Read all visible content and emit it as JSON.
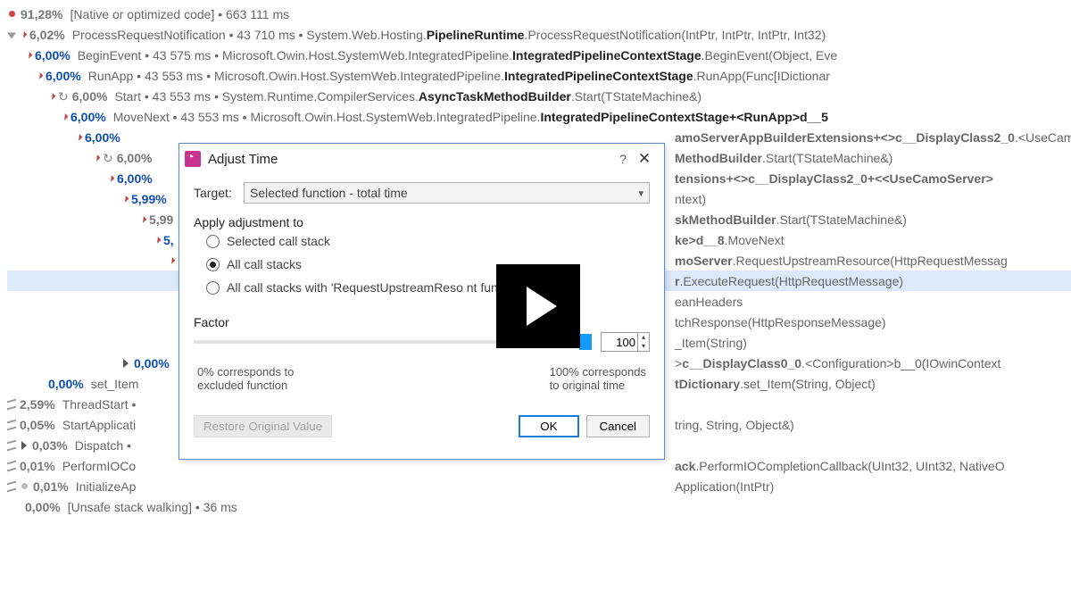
{
  "rows": [
    {
      "indent": 0,
      "glyph": "dot-red",
      "pct": "91,28%",
      "pctStyle": "gray",
      "text": "[Native or optimized code]  •  663 111 ms",
      "cls": ""
    },
    {
      "indent": 0,
      "glyph": "tri-open",
      "pre": "tick-solid",
      "pct": "6,02%",
      "pctStyle": "gray",
      "text": "ProcessRequestNotification  •  43 710 ms  •  System.Web.Hosting.<b>PipelineRuntime</b>.ProcessRequestNotification(IntPtr, IntPtr, IntPtr, Int32)"
    },
    {
      "indent": 1,
      "glyph": "tri-open",
      "pct": "6,00%",
      "pctStyle": "blue",
      "text": "BeginEvent  •  43 575 ms  •  Microsoft.Owin.Host.SystemWeb.IntegratedPipeline.<b>IntegratedPipelineContextStage</b>.BeginEvent(Object, Eve"
    },
    {
      "indent": 2,
      "glyph": "tri-open",
      "pct": "6,00%",
      "pctStyle": "blue",
      "text": "RunApp  •  43 553 ms  •  Microsoft.Owin.Host.SystemWeb.IntegratedPipeline.<b>IntegratedPipelineContextStage</b>.RunApp(Func[IDictionar"
    },
    {
      "indent": 3,
      "glyph": "tri-open",
      "cycle": "↻",
      "pct": "6,00%",
      "pctStyle": "gray",
      "text": "Start  •  43 553 ms  •  System.Runtime.CompilerServices.<b>AsyncTaskMethodBuilder</b>.Start(TStateMachine&)"
    },
    {
      "indent": 4,
      "glyph": "tri-open",
      "pct": "6,00%",
      "pctStyle": "blue",
      "text": "MoveNext  •  43 553 ms  •  Microsoft.Owin.Host.SystemWeb.IntegratedPipeline.<b>IntegratedPipelineContextStage+&lt;RunApp&gt;d__5</b>"
    },
    {
      "indent": 5,
      "glyph": "tri-open",
      "pct": "6,00%",
      "pctStyle": "blue",
      "tail": "<b>amoServerAppBuilderExtensions+&lt;&gt;c__DisplayClass2_0</b>.&lt;UseCamoSer"
    },
    {
      "indent": 6,
      "glyph": "tri-open",
      "cycle": "↻",
      "pct": "6,00%",
      "pctStyle": "gray",
      "tail": "<b>MethodBuilder</b>.Start(TStateMachine&)"
    },
    {
      "indent": 7,
      "glyph": "tri-open",
      "pct": "6,00%",
      "pctStyle": "blue",
      "tail": "<b>tensions+&lt;&gt;c__DisplayClass2_0+&lt;&lt;UseCamoServer&gt;</b>"
    },
    {
      "indent": 8,
      "glyph": "tri-open",
      "pct": "5,99%",
      "pctStyle": "blue",
      "tail": "ntext)"
    },
    {
      "indent": 9,
      "glyph": "tri-open",
      "pct": "5,99",
      "pctStyle": "gray",
      "tail": "<b>skMethodBuilder</b>.Start(TStateMachine&)"
    },
    {
      "indent": 10,
      "glyph": "tri-open",
      "pct": "5,",
      "pctStyle": "blue",
      "tail": "<b>ke&gt;d__8</b>.MoveNext"
    },
    {
      "indent": 11,
      "glyph": "tri-open",
      "pct": "",
      "tail": "<b>moServer</b>.RequestUpstreamResource(HttpRequestMessag"
    },
    {
      "indent": 12,
      "glyph": "",
      "pct": "",
      "tail": "<b>r</b>.ExecuteRequest(HttpRequestMessage)",
      "highlight": true
    },
    {
      "indent": 12,
      "glyph": "tri-right",
      "pct": "",
      "tail": "eanHeaders"
    },
    {
      "indent": 12,
      "glyph": "tri-right",
      "pct": "",
      "tail": "tchResponse(HttpResponseMessage)"
    },
    {
      "indent": 12,
      "glyph": "tri-right",
      "pct": "",
      "tail": "_Item(String)"
    },
    {
      "indent": 8,
      "glyph": "tri-right",
      "pct": "0,00%",
      "pctStyle": "blue",
      "tail": "&gt;<b>c__DisplayClass0_0</b>.&lt;Configuration&gt;b__0(IOwinContext"
    },
    {
      "indent": 3,
      "glyph": "",
      "pct": "0,00%",
      "pctStyle": "blue",
      "text": "set_Item",
      "tail": "<b>tDictionary</b>.set_Item(String, Object)"
    },
    {
      "indent": 0,
      "glyph": "",
      "pre": "tick-line",
      "pct": "2,59%",
      "pctStyle": "gray",
      "text": "ThreadStart  •"
    },
    {
      "indent": 0,
      "glyph": "",
      "pre": "tick-line",
      "pct": "0,05%",
      "pctStyle": "gray",
      "text": "StartApplicati",
      "tail": "tring, String, Object&)"
    },
    {
      "indent": 0,
      "glyph": "tri-right",
      "pre": "tick-line",
      "pct": "0,03%",
      "pctStyle": "gray",
      "text": "Dispatch  •"
    },
    {
      "indent": 0,
      "glyph": "",
      "pre": "tick-line",
      "pct": "0,01%",
      "pctStyle": "gray",
      "text": "PerformIOCo",
      "tail": "<b>ack</b>.PerformIOCompletionCallback(UInt32, UInt32, NativeO"
    },
    {
      "indent": 0,
      "glyph": "dot-gray",
      "pre": "tick-line",
      "pct": "0,01%",
      "pctStyle": "gray",
      "text": "InitializeAp",
      "tail": "Application(IntPtr)"
    },
    {
      "indent": 1,
      "glyph": "",
      "pct": "0,00%",
      "pctStyle": "gray",
      "text": "[Unsafe stack walking]  •  36 ms"
    }
  ],
  "dialog": {
    "title": "Adjust Time",
    "target_label": "Target:",
    "target_value": "Selected function - total time",
    "apply_label": "Apply adjustment to",
    "opt1": "Selected call stack",
    "opt2": "All call stacks",
    "opt3": "All call stacks with 'RequestUpstreamReso                 nt function",
    "factor_label": "Factor",
    "factor_value": "100",
    "note_left_1": "0% corresponds to",
    "note_left_2": "excluded function",
    "note_right_1": "100% corresponds",
    "note_right_2": "to original time",
    "restore": "Restore Original Value",
    "ok": "OK",
    "cancel": "Cancel"
  }
}
